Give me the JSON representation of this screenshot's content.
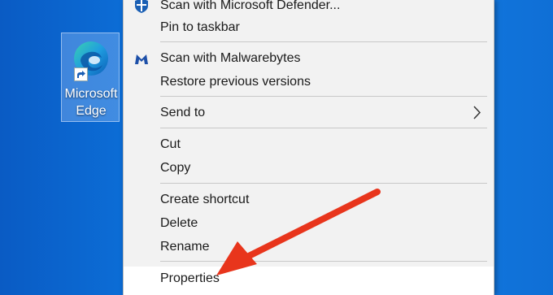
{
  "desktop": {
    "icon_label": "Microsoft\nEdge"
  },
  "menu": {
    "items": [
      {
        "label": "Scan with Microsoft Defender...",
        "icon": "defender-shield-icon"
      },
      {
        "label": "Pin to taskbar",
        "icon": ""
      },
      {
        "label": "Scan with Malwarebytes",
        "icon": "malwarebytes-icon"
      },
      {
        "label": "Restore previous versions",
        "icon": ""
      },
      {
        "label": "Send to",
        "icon": "chevron-right-icon"
      },
      {
        "label": "Cut",
        "icon": ""
      },
      {
        "label": "Copy",
        "icon": ""
      },
      {
        "label": "Create shortcut",
        "icon": ""
      },
      {
        "label": "Delete",
        "icon": ""
      },
      {
        "label": "Rename",
        "icon": ""
      },
      {
        "label": "Properties",
        "icon": ""
      }
    ]
  },
  "colors": {
    "desktop_blue": "#0c6fd8",
    "menu_background": "#f2f2f2",
    "highlight": "#ffffff",
    "arrow_red": "#e8351c"
  }
}
